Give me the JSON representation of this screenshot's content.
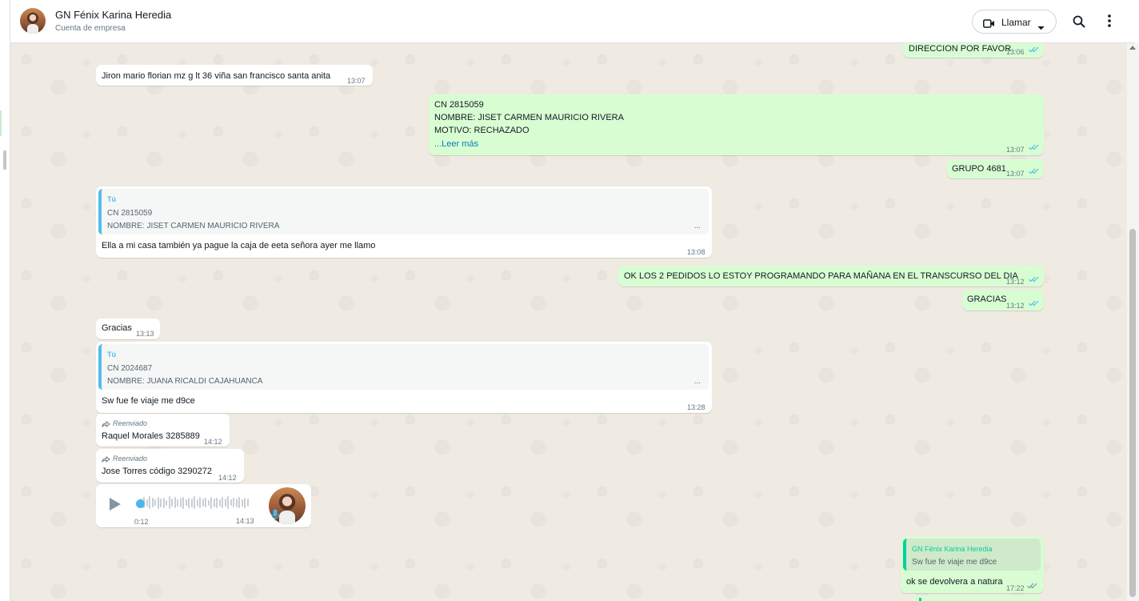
{
  "header": {
    "contact_name": "GN Fénix Karina Heredia",
    "subtitle": "Cuenta de empresa",
    "call_label": "Llamar"
  },
  "icons": {
    "call": "video-camera-icon",
    "call_menu": "chevron-down-icon",
    "search": "search-icon",
    "menu": "kebab-menu-icon",
    "forwarded": "forward-arrow-icon",
    "play": "play-icon",
    "mic": "microphone-icon",
    "read": "double-check-icon"
  },
  "colors": {
    "outgoing_bubble": "#d9fdd3",
    "incoming_bubble": "#ffffff",
    "chat_background": "#efeae2",
    "read_ticks": "#53bdeb",
    "quote_bar_blue": "#53bdeb",
    "quote_bar_green": "#06cf9c"
  },
  "messages": {
    "m1": {
      "text": "DIRECCION POR FAVOR",
      "time": "13:06"
    },
    "m2": {
      "text": "Jiron mario florian mz g lt 36 viña san francisco santa anita",
      "time": "13:07"
    },
    "m3": {
      "lines": [
        "CN 2815059",
        "NOMBRE: JISET CARMEN MAURICIO RIVERA",
        "MOTIVO: RECHAZADO"
      ],
      "read_more": "...Leer más",
      "time": "13:07"
    },
    "m4": {
      "text": "GRUPO 4681",
      "time": "13:07"
    },
    "m5": {
      "quote_author": "Tú",
      "quote_lines": [
        "CN 2815059",
        "NOMBRE: JISET CARMEN MAURICIO RIVERA"
      ],
      "quote_more": "...",
      "text": "Ella a mi casa también ya pague la caja de eeta señora ayer me llamo",
      "time": "13:08"
    },
    "m6": {
      "text": "OK LOS 2 PEDIDOS LO ESTOY PROGRAMANDO PARA MAÑANA EN EL TRANSCURSO DEL DIA",
      "time": "13:12"
    },
    "m7": {
      "text": "GRACIAS",
      "time": "13:12"
    },
    "m8": {
      "text": "Gracias",
      "time": "13:13"
    },
    "m9": {
      "quote_author": "Tú",
      "quote_lines": [
        "CN 2024687",
        "NOMBRE: JUANA RICALDI CAJAHUANCA"
      ],
      "quote_more": "...",
      "text": "Sw fue fe viaje me d9ce",
      "time": "13:28"
    },
    "m10": {
      "forwarded": "Reenviado",
      "text": "Raquel Morales 3285889",
      "time": "14:12"
    },
    "m11": {
      "forwarded": "Reenviado",
      "text": "Jose Torres código 3290272",
      "time": "14:12"
    },
    "m12": {
      "duration": "0:12",
      "time": "14:13",
      "progress": 0.0
    },
    "m13": {
      "quote_author": "GN Fénix Karina Heredia",
      "quote_line": "Sw fue fe viaje me d9ce",
      "text": "ok se devolvera a natura",
      "time": "17:22"
    }
  }
}
